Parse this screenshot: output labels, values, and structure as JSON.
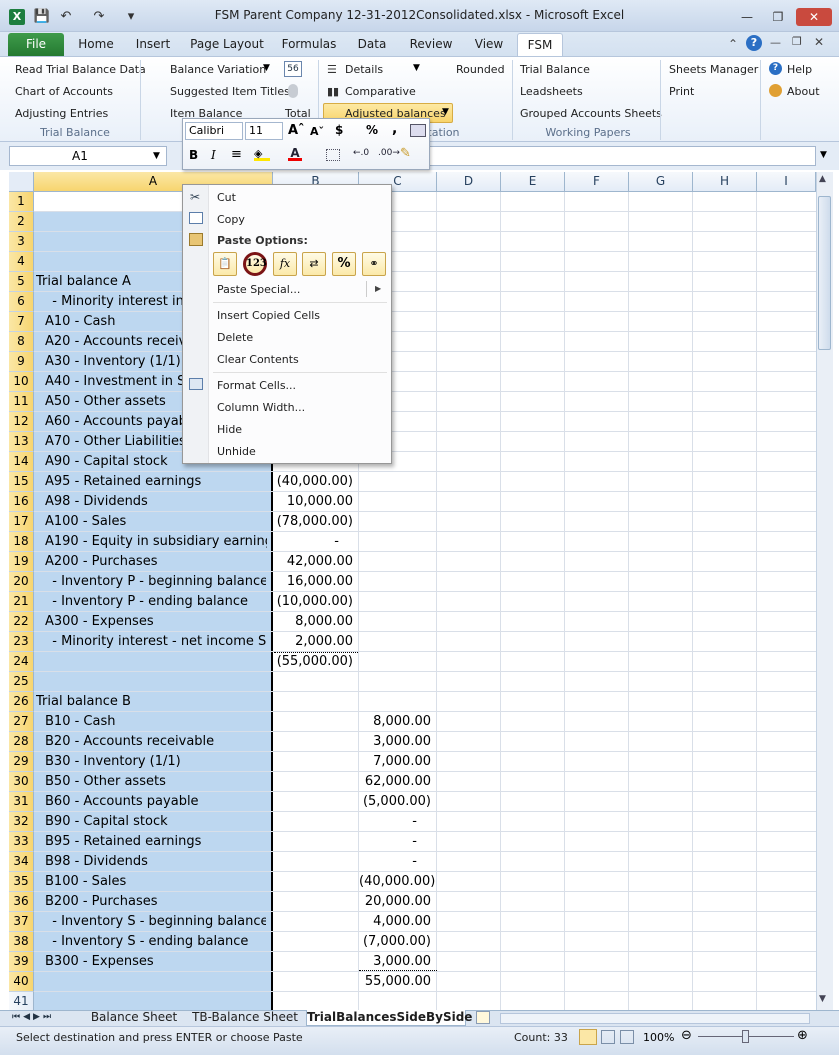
{
  "window": {
    "title": "FSM Parent Company 12-31-2012Consolidated.xlsx - Microsoft Excel",
    "app_icon": "X"
  },
  "tabs": [
    "File",
    "Home",
    "Insert",
    "Page Layout",
    "Formulas",
    "Data",
    "Review",
    "View",
    "FSM"
  ],
  "ribbon": {
    "trial_balance_group": {
      "label": "Trial Balance",
      "items": [
        "Read Trial Balance Data",
        "Chart of Accounts",
        "Adjusting Entries"
      ]
    },
    "presentation_group": {
      "label": "ntation",
      "balance_variation": "Balance Variation",
      "suggested_item_titles": "Suggested Item Titles",
      "item_balance": "Item Balance",
      "total": "Total",
      "details": "Details",
      "comparative": "Comparative",
      "rounded": "Rounded",
      "adjusted_balances": "Adjusted balances"
    },
    "working_papers_group": {
      "label": "Working Papers",
      "items": [
        "Trial Balance",
        "Leadsheets",
        "Grouped Accounts Sheets"
      ]
    },
    "other": {
      "sheets_manager": "Sheets Manager",
      "print": "Print",
      "help": "Help",
      "about": "About"
    }
  },
  "formula_bar": {
    "name_box": "A1"
  },
  "mini_toolbar": {
    "font": "Calibri",
    "size": "11"
  },
  "columns": [
    "A",
    "B",
    "C",
    "D",
    "E",
    "F",
    "G",
    "H",
    "I"
  ],
  "rows": [
    {
      "n": "1",
      "a": "",
      "b": "",
      "c": ""
    },
    {
      "n": "2",
      "a": "",
      "b": "",
      "c": ""
    },
    {
      "n": "3",
      "a": "",
      "b": "",
      "c": ""
    },
    {
      "n": "4",
      "a": "",
      "b": "",
      "c": ""
    },
    {
      "n": "5",
      "a": "Trial balance A",
      "b": "",
      "c": ""
    },
    {
      "n": "6",
      "a": "  - Minority interest in",
      "b": "",
      "c": ""
    },
    {
      "n": "7",
      "a": "A10 - Cash",
      "b": "",
      "c": ""
    },
    {
      "n": "8",
      "a": "A20 - Accounts receiva",
      "b": "",
      "c": ""
    },
    {
      "n": "9",
      "a": "A30 - Inventory (1/1)",
      "b": "",
      "c": ""
    },
    {
      "n": "10",
      "a": "A40 - Investment in S C",
      "b": "",
      "c": ""
    },
    {
      "n": "11",
      "a": "A50 - Other assets",
      "b": "",
      "c": ""
    },
    {
      "n": "12",
      "a": "A60 - Accounts payable",
      "b": "",
      "c": ""
    },
    {
      "n": "13",
      "a": "A70 - Other Liabilities",
      "b": "",
      "c": ""
    },
    {
      "n": "14",
      "a": "A90 - Capital stock",
      "b": "",
      "c": ""
    },
    {
      "n": "15",
      "a": "A95 - Retained earnings",
      "b": "(40,000.00)",
      "c": ""
    },
    {
      "n": "16",
      "a": "A98 - Dividends",
      "b": "10,000.00",
      "c": ""
    },
    {
      "n": "17",
      "a": "A100 - Sales",
      "b": "(78,000.00)",
      "c": ""
    },
    {
      "n": "18",
      "a": "A190 - Equity in subsidiary earnings",
      "b": "-",
      "c": ""
    },
    {
      "n": "19",
      "a": "A200 - Purchases",
      "b": "42,000.00",
      "c": ""
    },
    {
      "n": "20",
      "a": "  - Inventory P - beginning balance",
      "b": "16,000.00",
      "c": ""
    },
    {
      "n": "21",
      "a": "  - Inventory P - ending balance",
      "b": "(10,000.00)",
      "c": ""
    },
    {
      "n": "22",
      "a": "A300 - Expenses",
      "b": "8,000.00",
      "c": ""
    },
    {
      "n": "23",
      "a": "  - Minority interest - net income S",
      "b": "2,000.00",
      "c": ""
    },
    {
      "n": "24",
      "a": "",
      "b": "(55,000.00)",
      "c": ""
    },
    {
      "n": "25",
      "a": "",
      "b": "",
      "c": ""
    },
    {
      "n": "26",
      "a": "Trial balance B",
      "b": "",
      "c": ""
    },
    {
      "n": "27",
      "a": "B10 - Cash",
      "b": "",
      "c": "8,000.00"
    },
    {
      "n": "28",
      "a": "B20 - Accounts receivable",
      "b": "",
      "c": "3,000.00"
    },
    {
      "n": "29",
      "a": "B30 - Inventory (1/1)",
      "b": "",
      "c": "7,000.00"
    },
    {
      "n": "30",
      "a": "B50 - Other assets",
      "b": "",
      "c": "62,000.00"
    },
    {
      "n": "31",
      "a": "B60 - Accounts payable",
      "b": "",
      "c": "(5,000.00)"
    },
    {
      "n": "32",
      "a": "B90 - Capital stock",
      "b": "",
      "c": "-"
    },
    {
      "n": "33",
      "a": "B95 - Retained earnings",
      "b": "",
      "c": "-"
    },
    {
      "n": "34",
      "a": "B98 - Dividends",
      "b": "",
      "c": "-"
    },
    {
      "n": "35",
      "a": "B100 - Sales",
      "b": "",
      "c": "(40,000.00)"
    },
    {
      "n": "36",
      "a": "B200 - Purchases",
      "b": "",
      "c": "20,000.00"
    },
    {
      "n": "37",
      "a": "  - Inventory S - beginning balance",
      "b": "",
      "c": "4,000.00"
    },
    {
      "n": "38",
      "a": "  - Inventory S - ending balance",
      "b": "",
      "c": "(7,000.00)"
    },
    {
      "n": "39",
      "a": "B300 - Expenses",
      "b": "",
      "c": "3,000.00"
    },
    {
      "n": "40",
      "a": "",
      "b": "",
      "c": "55,000.00"
    },
    {
      "n": "41",
      "a": "",
      "b": "",
      "c": ""
    }
  ],
  "context_menu": {
    "cut": "Cut",
    "copy": "Copy",
    "paste_options": "Paste Options:",
    "paste_buttons": [
      "paste-icon",
      "values-123-icon",
      "formulas-fx-icon",
      "transpose-icon",
      "formatting-percent-icon",
      "paste-link-icon"
    ],
    "paste_values_label": "123",
    "paste_formulas_label": "fx",
    "paste_percent_label": "%",
    "paste_special": "Paste Special...",
    "insert_copied_cells": "Insert Copied Cells",
    "delete": "Delete",
    "clear_contents": "Clear Contents",
    "format_cells": "Format Cells...",
    "column_width": "Column Width...",
    "hide": "Hide",
    "unhide": "Unhide"
  },
  "sheet_tabs": [
    "Balance Sheet",
    "TB-Balance Sheet",
    "TrialBalancesSideBySide"
  ],
  "status": {
    "message": "Select destination and press ENTER or choose Paste",
    "count": "Count: 33",
    "zoom": "100%"
  },
  "colors": {
    "accent_green": "#247a31",
    "selection_blue": "#bdd7f0",
    "header_gold": "#f7d56f"
  }
}
